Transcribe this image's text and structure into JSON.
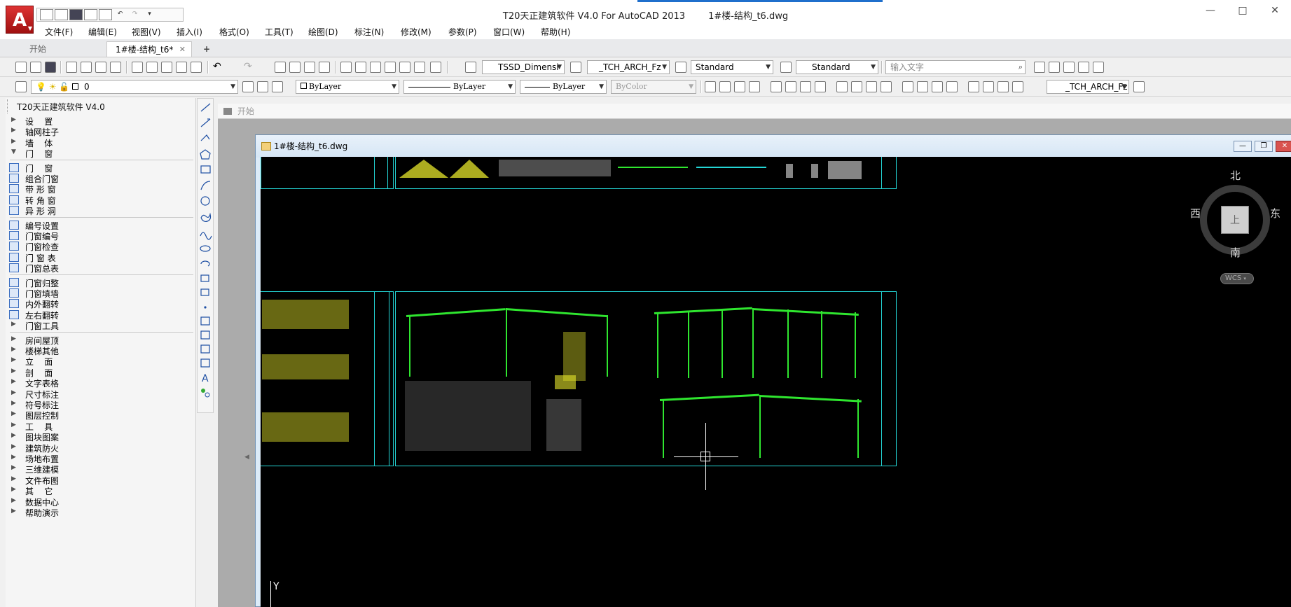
{
  "app": {
    "title": "T20天正建筑软件 V4.0 For AutoCAD 2013        1#楼-结构_t6.dwg",
    "logo": "A",
    "window_controls": [
      "—",
      "□",
      "✕"
    ]
  },
  "menubar": [
    "文件(F)",
    "编辑(E)",
    "视图(V)",
    "插入(I)",
    "格式(O)",
    "工具(T)",
    "绘图(D)",
    "标注(N)",
    "修改(M)",
    "参数(P)",
    "窗口(W)",
    "帮助(H)"
  ],
  "doc_tabs": [
    {
      "label": "开始"
    },
    {
      "label": "1#楼-结构_t6*",
      "close": "✕"
    },
    {
      "label": "+"
    }
  ],
  "toolbar": {
    "text_style": "TSSD_Dimensi",
    "dim_style": "_TCH_ARCH_Fz",
    "table_style": "Standard",
    "mleader_style": "Standard",
    "search_placeholder": "输入文字",
    "layer": "0",
    "color": "ByLayer",
    "linetype": "ByLayer",
    "lineweight": "ByLayer",
    "plotstyle": "ByColor",
    "dim_style_2": "_TCH_ARCH_Fz"
  },
  "panel": {
    "title": "T20天正建筑软件 V4.0",
    "top_items": [
      {
        "label": "设    置",
        "expanded": false
      },
      {
        "label": "轴网柱子",
        "expanded": false
      },
      {
        "label": "墙    体",
        "expanded": false
      },
      {
        "label": "门    窗",
        "expanded": true
      }
    ],
    "sub_group1": [
      "门    窗",
      "组合门窗",
      "带 形 窗",
      "转 角 窗",
      "异 形 洞"
    ],
    "sub_group2": [
      "编号设置",
      "门窗编号",
      "门窗检查",
      "门 窗 表",
      "门窗总表"
    ],
    "sub_group3": [
      "门窗归整",
      "门窗填墙",
      "内外翻转",
      "左右翻转",
      "门窗工具"
    ],
    "bottom_items": [
      "房间屋顶",
      "楼梯其他",
      "立    面",
      "剖    面",
      "文字表格",
      "尺寸标注",
      "符号标注",
      "图层控制",
      "工    具",
      "图块图案",
      "建筑防火",
      "场地布置",
      "三维建模",
      "文件布图",
      "其    它",
      "数据中心",
      "帮助演示"
    ]
  },
  "mdi": {
    "start_label": "开始",
    "doc_title": "1#楼-结构_t6.dwg"
  },
  "viewcube": {
    "north": "北",
    "south": "南",
    "east": "东",
    "west": "西",
    "top": "上",
    "wcs": "WCS"
  },
  "ucs": {
    "y": "Y"
  },
  "colors": {
    "accent": "#1f6fcc",
    "frame": "#24d6d6",
    "steel": "#2fe62f",
    "annotation": "#e6e62b",
    "canvas": "#000000"
  }
}
